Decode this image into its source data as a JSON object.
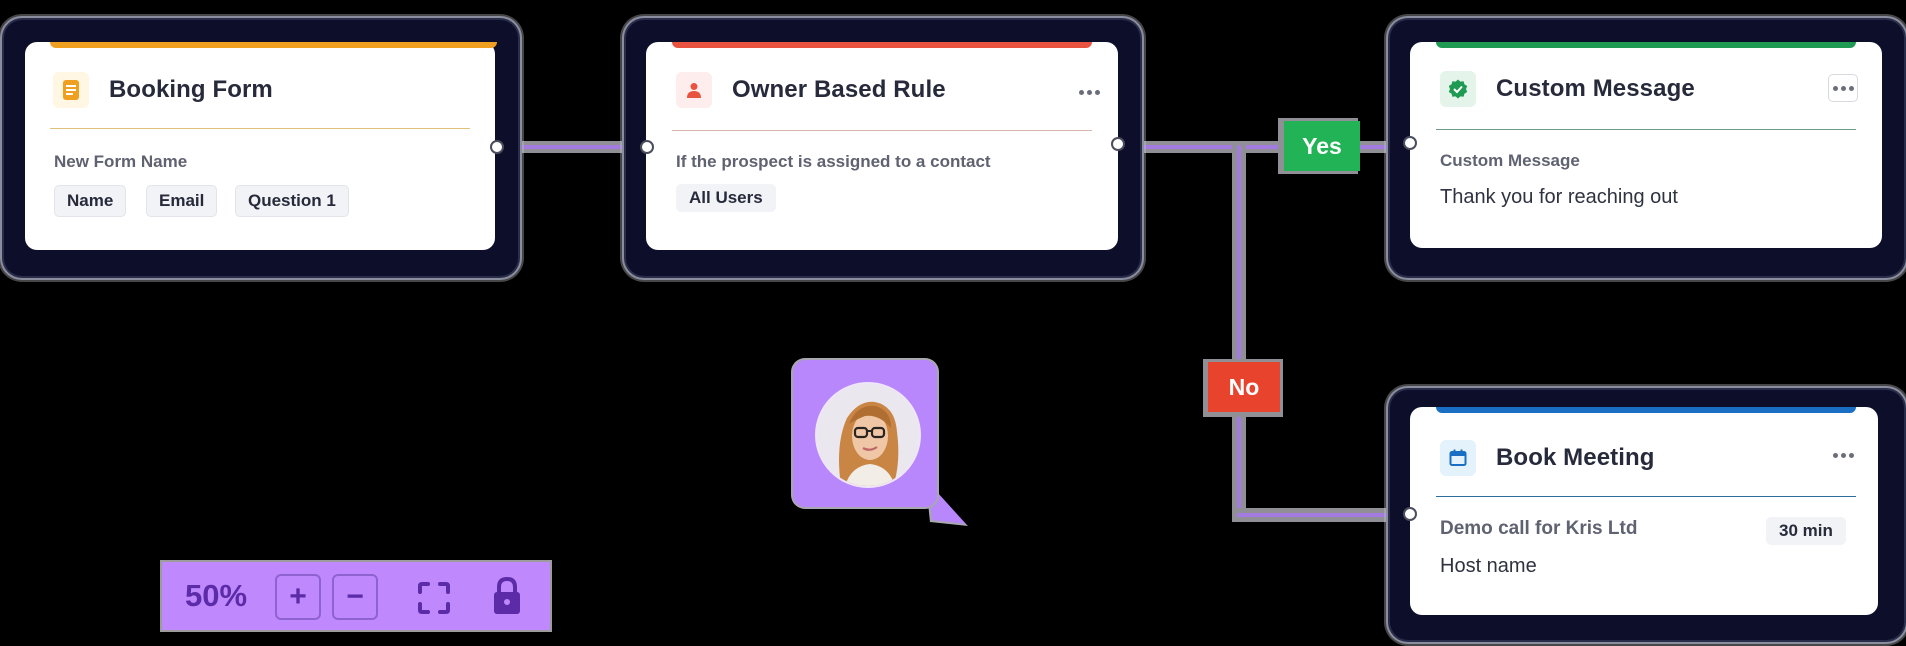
{
  "canvas": {
    "background": "#000000",
    "connector_color": "#a47be0"
  },
  "nodes": {
    "booking_form": {
      "title": "Booking Form",
      "accent_color": "#f0a020",
      "icon": "form-icon",
      "field_label": "New Form Name",
      "chips": [
        "Name",
        "Email",
        "Question 1"
      ]
    },
    "owner_rule": {
      "title": "Owner Based Rule",
      "accent_color": "#e8533f",
      "icon": "user-icon",
      "condition": "If the prospect is assigned to a contact",
      "chip": "All Users"
    },
    "custom_message": {
      "title": "Custom Message",
      "accent_color": "#1e9a52",
      "icon": "verified-badge-icon",
      "field_label": "Custom Message",
      "message": "Thank you for reaching out"
    },
    "book_meeting": {
      "title": "Book Meeting",
      "accent_color": "#1a6fc4",
      "icon": "calendar-icon",
      "meeting_name": "Demo call for Kris Ltd",
      "duration": "30 min",
      "host_label": "Host name"
    }
  },
  "branches": {
    "yes": {
      "label": "Yes",
      "color": "#21b356"
    },
    "no": {
      "label": "No",
      "color": "#e8432c"
    }
  },
  "toolbar": {
    "zoom_level": "50%",
    "zoom_in_label": "+",
    "zoom_out_label": "−",
    "fit_icon": "fit-screen-icon",
    "lock_icon": "lock-icon",
    "background": "#bf88fc"
  },
  "collaborator": {
    "avatar_alt": "Collaborator avatar",
    "bubble_color": "#b787fb"
  }
}
